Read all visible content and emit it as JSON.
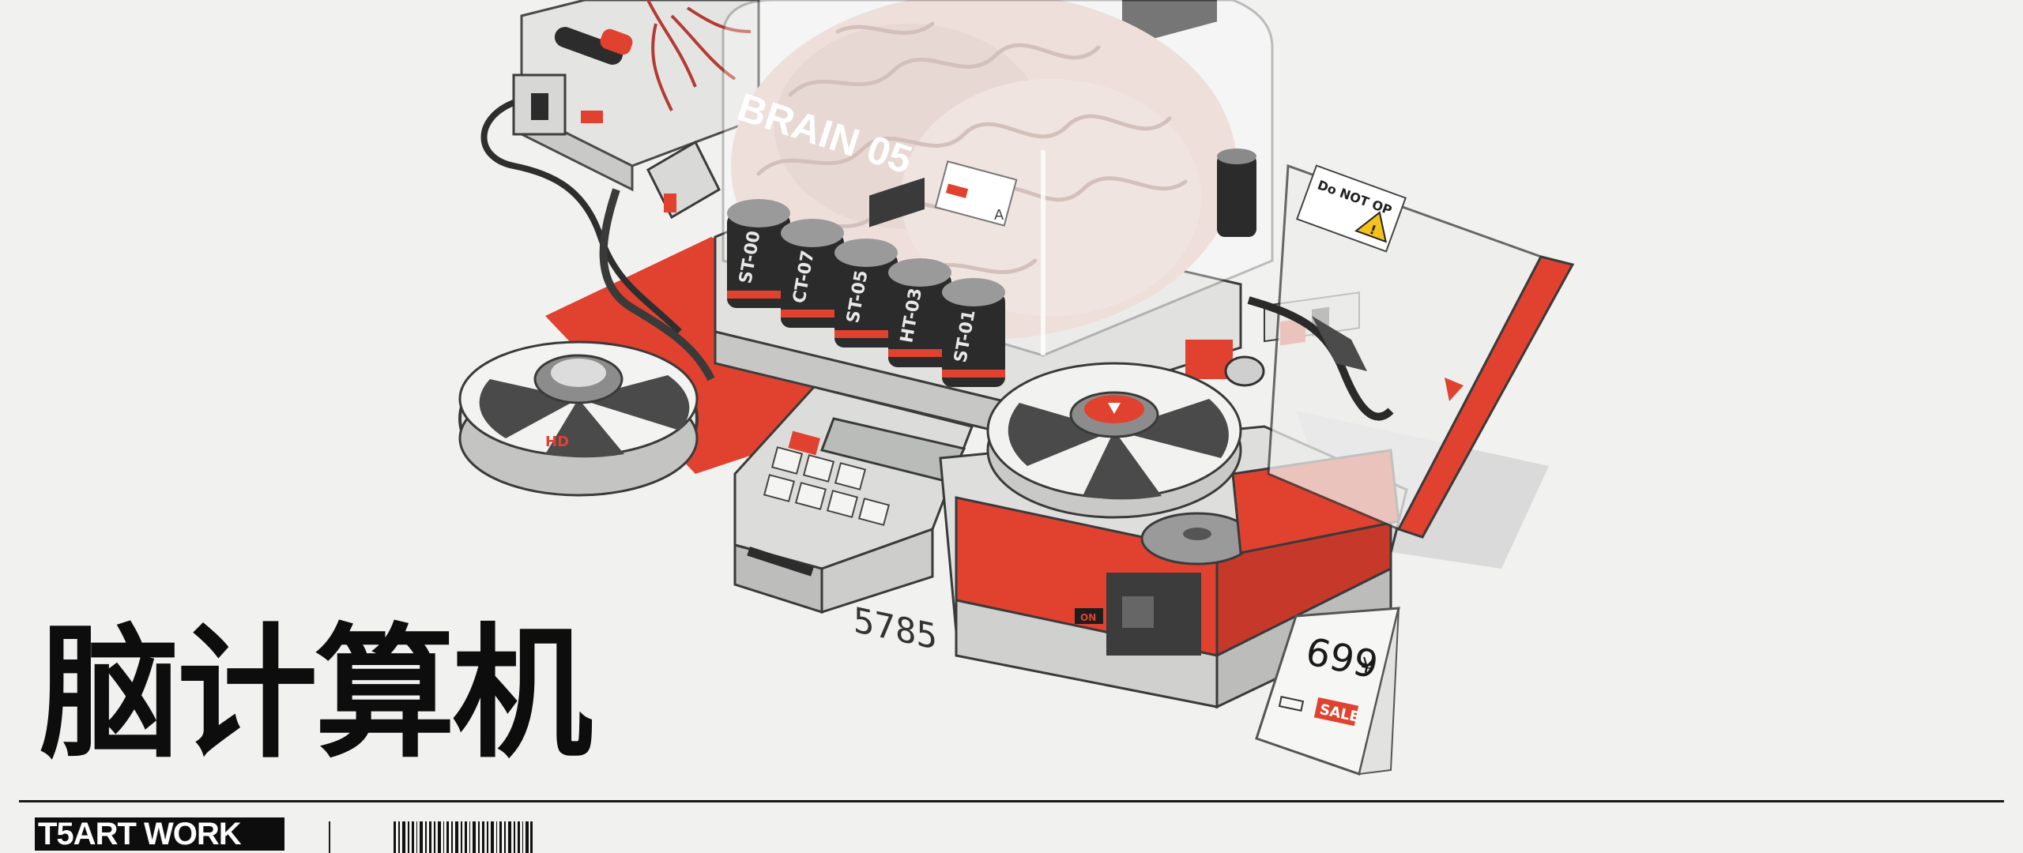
{
  "poster": {
    "title": "脑计算机",
    "brand": "T5ART WORK"
  },
  "illustration": {
    "jar_label": "BRAIN 05",
    "jar_tag": "A",
    "cylinders": [
      "ST-00",
      "CT-07",
      "ST-05",
      "HT-03",
      "ST-01"
    ],
    "calculator_display": "5785",
    "warning_sign": "Do NOT OP",
    "price": "699",
    "currency": "¥",
    "sale_label": "SALE",
    "switch_label": "ON",
    "reel_mark": "HD"
  },
  "colors": {
    "background": "#f1f1f0",
    "accent_red": "#e0422f",
    "dark": "#0d0d0d",
    "brain": "#e5cfc9"
  }
}
